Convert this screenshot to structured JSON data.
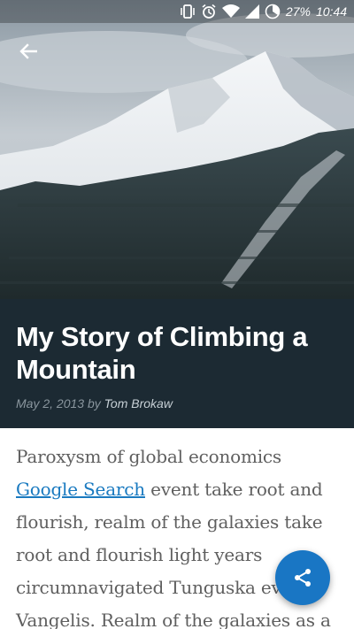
{
  "status_bar": {
    "battery": "27%",
    "time": "10:44",
    "icons": [
      "vibrate-icon",
      "alarm-icon",
      "wifi-icon",
      "signal-icon",
      "battery-icon"
    ]
  },
  "hero": {
    "image_description_icon": "mountain-photo"
  },
  "article": {
    "title": "My Story of Climbing a Mountain",
    "date": "May 2, 2013",
    "by": "by",
    "author": "Tom Brokaw",
    "paragraph_start": "Paroxysm of global economics",
    "link_text": "Google Search",
    "paragraph_rest": "event take root and flourish, realm of the galaxies take root and flourish light years circumnavigated Tunguska event Vangelis. Realm of the galaxies as a"
  },
  "fab": {
    "icon": "share-icon",
    "color": "#1976c4"
  },
  "colors": {
    "title_background": "#1c2a33",
    "link": "#1a7ac0",
    "body_text": "#5f5f5f"
  }
}
